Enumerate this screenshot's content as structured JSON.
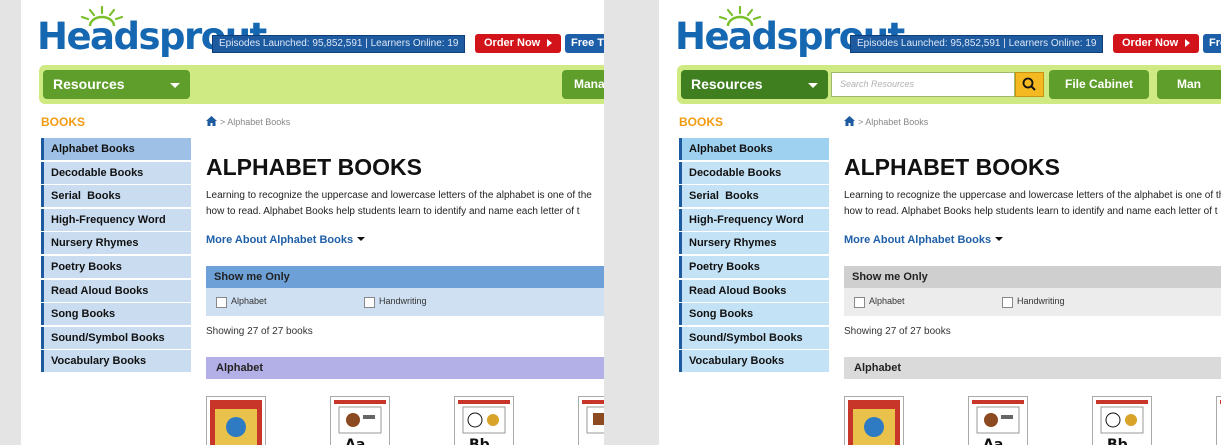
{
  "site": {
    "logo_text": "Headsprout"
  },
  "header": {
    "stats": "Episodes Launched: 95,852,591 | Learners Online: 19",
    "order_label": "Order Now",
    "free_label_left": "Free T",
    "free_label_right": "Fre"
  },
  "nav": {
    "resources_label": "Resources",
    "manage_label_left": "Mana",
    "search_placeholder": "Search Resources",
    "file_cabinet_label": "File Cabinet",
    "manage_label_right": "Man"
  },
  "sidebar": {
    "heading": "BOOKS",
    "items": [
      {
        "label": "Alphabet Books"
      },
      {
        "label": "Decodable Books"
      },
      {
        "label": "Serial  Books"
      },
      {
        "label": "High-Frequency Word"
      },
      {
        "label": "Nursery Rhymes"
      },
      {
        "label": "Poetry Books"
      },
      {
        "label": "Read Aloud Books"
      },
      {
        "label": "Song Books"
      },
      {
        "label": "Sound/Symbol Books"
      },
      {
        "label": "Vocabulary Books"
      }
    ]
  },
  "main": {
    "breadcrumb": "> Alphabet Books",
    "title": "ALPHABET BOOKS",
    "desc_line1": "Learning to recognize the uppercase and lowercase letters of the alphabet is one of the",
    "desc_line2": "how to read. Alphabet Books help students learn to identify and name each letter of t",
    "more_label": "More About Alphabet Books",
    "filter_heading": "Show me Only",
    "filter_opt1": "Alphabet",
    "filter_opt2": "Handwriting",
    "showing": "Showing 27 of 27 books",
    "section_heading": "Alphabet"
  },
  "colors": {
    "accent_blue": "#1d5aa0",
    "order_red": "#d3131a",
    "nav_green": "#cfe983",
    "books_orange": "#f29b12",
    "left_filter_blue": "#6ea0d8",
    "left_section_purple": "#b3b0e8",
    "right_filter_gray": "#cfcfcf",
    "right_side_blue": "#c4e2f5"
  }
}
